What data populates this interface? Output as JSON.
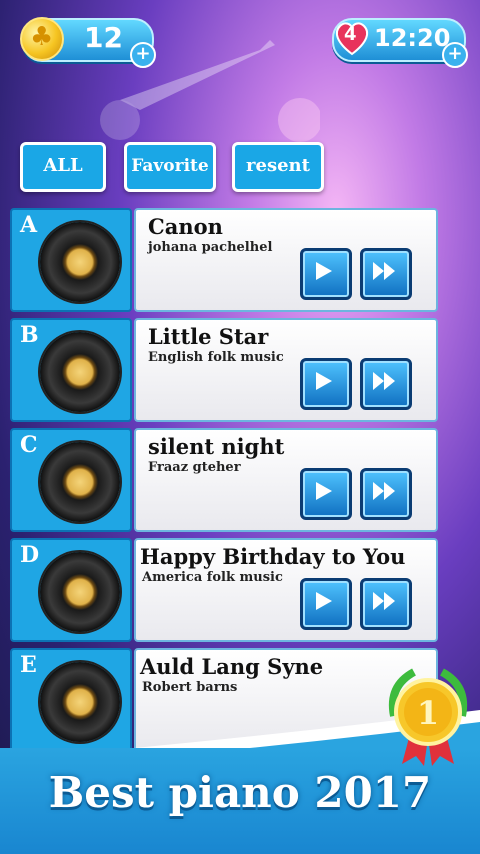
{
  "top": {
    "coins": "12",
    "lives": "4",
    "timer": "12:20"
  },
  "tabs": [
    {
      "label": "ALL"
    },
    {
      "label": "Favorite"
    },
    {
      "label": "resent"
    }
  ],
  "songs": [
    {
      "letter": "A",
      "title": "Canon",
      "artist": "johana pachelhel"
    },
    {
      "letter": "B",
      "title": "Little Star",
      "artist": "English folk music"
    },
    {
      "letter": "C",
      "title": "silent night",
      "artist": "Fraaz gteher"
    },
    {
      "letter": "D",
      "title": "Happy Birthday to You",
      "artist": "America folk music"
    },
    {
      "letter": "E",
      "title": "Auld Lang Syne",
      "artist": "Robert barns"
    }
  ],
  "banner": {
    "text": "Best piano 2017",
    "medal_number": "1"
  },
  "colors": {
    "accent": "#1fa6e4",
    "banner": "#1986d0",
    "gold": "#f6c522"
  }
}
